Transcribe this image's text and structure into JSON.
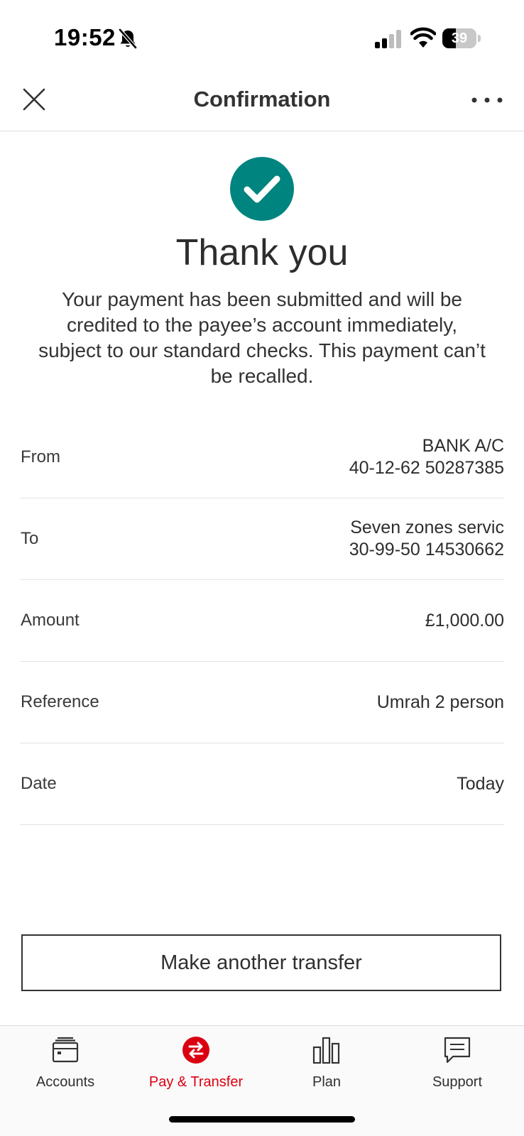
{
  "status_bar": {
    "time": "19:52",
    "battery_level": 39,
    "icons": [
      "bell-slash-icon",
      "signal-icon",
      "wifi-icon",
      "battery-icon"
    ]
  },
  "header": {
    "title": "Confirmation",
    "close_icon": "close-icon",
    "more_icon": "more-options-icon"
  },
  "success": {
    "icon": "check-circle-icon",
    "title": "Thank you",
    "message": "Your payment has been submitted and will be credited to the payee’s account immediately, subject to our standard checks. This payment can’t be recalled."
  },
  "details": {
    "from": {
      "label": "From",
      "line1": "BANK A/C",
      "line2": "40-12-62 50287385"
    },
    "to": {
      "label": "To",
      "line1": "Seven zones servic",
      "line2": "30-99-50 14530662"
    },
    "amount": {
      "label": "Amount",
      "value": "£1,000.00"
    },
    "reference": {
      "label": "Reference",
      "value": "Umrah 2 person"
    },
    "date": {
      "label": "Date",
      "value": "Today"
    }
  },
  "actions": {
    "make_another_transfer": "Make another transfer"
  },
  "tab_bar": {
    "tabs": [
      {
        "label": "Accounts",
        "icon": "wallet-icon",
        "active": false
      },
      {
        "label": "Pay & Transfer",
        "icon": "transfer-icon",
        "active": true
      },
      {
        "label": "Plan",
        "icon": "bar-chart-icon",
        "active": false
      },
      {
        "label": "Support",
        "icon": "chat-icon",
        "active": false
      }
    ]
  },
  "colors": {
    "success_green": "#00847f",
    "brand_red": "#db0011",
    "text": "#2b2b2b"
  }
}
